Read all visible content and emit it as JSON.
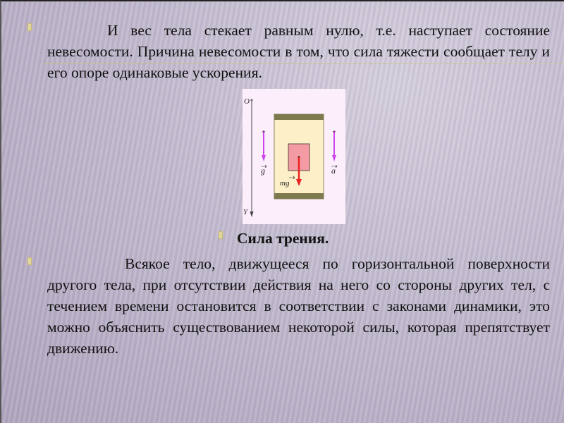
{
  "slide": {
    "paragraph1": "И вес тела стекает равным нулю, т.е. наступает состояние невесомости. Причина невесомости в том, что сила тяжести сообщает телу и его опоре одинаковые ускорения.",
    "heading": "Сила трения.",
    "paragraph2": "Всякое тело, движущееся по горизонтальной поверхности другого тела, при отсутствии действия на него со стороны других тел, с течением времени остановится в соответствии с законами динамики, это можно объяснить существованием некоторой силы, которая препятствует движению."
  },
  "figure": {
    "axis_top_label": "O",
    "axis_bottom_label": "Y",
    "label_g": "g",
    "label_a": "a",
    "label_mg": "mg",
    "colors": {
      "background": "#fdeefc",
      "box_fill": "#fdf0c8",
      "plates": "#7d7a4e",
      "body": "#f49aa3",
      "arrow_gravity": "#cc44ee",
      "arrow_force": "#ee2222"
    }
  }
}
